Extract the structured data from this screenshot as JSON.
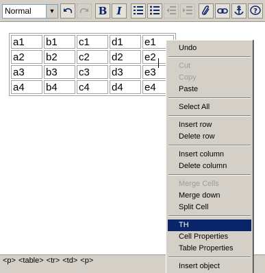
{
  "toolbar": {
    "format_value": "Normal",
    "buttons": [
      {
        "name": "undo-button",
        "icon": "undo-icon",
        "enabled": true
      },
      {
        "name": "redo-button",
        "icon": "redo-icon",
        "enabled": false
      },
      {
        "name": "bold-button",
        "icon": "bold-icon",
        "label": "B",
        "enabled": true
      },
      {
        "name": "italic-button",
        "icon": "italic-icon",
        "label": "I",
        "enabled": true
      },
      {
        "name": "ordered-list-button",
        "icon": "ordered-list-icon",
        "enabled": true
      },
      {
        "name": "unordered-list-button",
        "icon": "unordered-list-icon",
        "enabled": true
      },
      {
        "name": "outdent-button",
        "icon": "outdent-icon",
        "enabled": false
      },
      {
        "name": "indent-button",
        "icon": "indent-icon",
        "enabled": false
      },
      {
        "name": "attach-button",
        "icon": "paperclip-icon",
        "enabled": true
      },
      {
        "name": "link-button",
        "icon": "link-icon",
        "enabled": true
      },
      {
        "name": "anchor-button",
        "icon": "anchor-icon",
        "enabled": true
      },
      {
        "name": "help-button",
        "icon": "help-icon",
        "enabled": true
      }
    ]
  },
  "table": {
    "rows": [
      [
        "a1",
        "b1",
        "c1",
        "d1",
        "e1"
      ],
      [
        "a2",
        "b2",
        "c2",
        "d2",
        "e2"
      ],
      [
        "a3",
        "b3",
        "c3",
        "d3",
        "e3"
      ],
      [
        "a4",
        "b4",
        "c4",
        "d4",
        "e4"
      ]
    ]
  },
  "statusbar": {
    "path": [
      "<p>",
      "<table>",
      "<tr>",
      "<td>",
      "<p>"
    ]
  },
  "context_menu": {
    "items": [
      {
        "label": "Undo",
        "enabled": true
      },
      {
        "separator": true
      },
      {
        "label": "Cut",
        "enabled": false
      },
      {
        "label": "Copy",
        "enabled": false
      },
      {
        "label": "Paste",
        "enabled": true
      },
      {
        "separator": true
      },
      {
        "label": "Select All",
        "enabled": true
      },
      {
        "separator": true
      },
      {
        "label": "Insert row",
        "enabled": true
      },
      {
        "label": "Delete row",
        "enabled": true
      },
      {
        "separator": true
      },
      {
        "label": "Insert column",
        "enabled": true
      },
      {
        "label": "Delete column",
        "enabled": true
      },
      {
        "separator": true
      },
      {
        "label": "Merge Cells",
        "enabled": false
      },
      {
        "label": "Merge down",
        "enabled": true
      },
      {
        "label": "Split Cell",
        "enabled": true
      },
      {
        "separator": true
      },
      {
        "label": "TH",
        "enabled": true,
        "selected": true
      },
      {
        "label": "Cell Properties",
        "enabled": true
      },
      {
        "label": "Table Properties",
        "enabled": true
      },
      {
        "separator": true
      },
      {
        "label": "Insert object",
        "enabled": true
      }
    ]
  },
  "colors": {
    "chrome": "#d4d0c8",
    "selection": "#0a246a",
    "icon_blue": "#0a246a"
  }
}
